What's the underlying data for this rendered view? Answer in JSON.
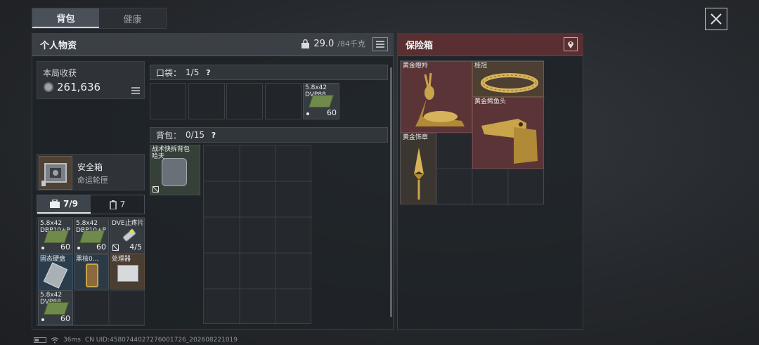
{
  "tabs": [
    {
      "label": "背包",
      "active": true
    },
    {
      "label": "健康",
      "active": false
    }
  ],
  "personal": {
    "title": "个人物资",
    "weight_current": "29.0",
    "weight_max": "/84千克",
    "earnings_label": "本局收获",
    "earnings_value": "261,636",
    "safe_box": {
      "name": "安全箱",
      "sub": "命运轮匣"
    },
    "subtabs": [
      {
        "label": "7/9",
        "icon": "toolbox-icon",
        "active": true
      },
      {
        "label": "7",
        "icon": "canister-icon",
        "active": false
      }
    ],
    "items": [
      {
        "name": "5.8x42\nDBP10+P",
        "count": "60"
      },
      {
        "name": "5.8x42\nDBP10+P",
        "count": "60"
      },
      {
        "name": "DVE止疼片",
        "count": "4/5"
      },
      {
        "name": "固态硬盘",
        "count": ""
      },
      {
        "name": "黑核0...",
        "count": ""
      },
      {
        "name": "处理器",
        "count": ""
      },
      {
        "name": "5.8x42\nDVP88",
        "count": "60"
      }
    ]
  },
  "pockets": {
    "label": "口袋：",
    "capacity": "1/5",
    "help": "?",
    "item": {
      "name": "5.8x42\nDVP88",
      "count": "60"
    }
  },
  "backpack": {
    "label": "背包：",
    "capacity": "0/15",
    "help": "?",
    "item": {
      "name": "战术快拆背包\n哈夫"
    }
  },
  "safe": {
    "title": "保险箱",
    "items": [
      {
        "name": "黄金瞪羚"
      },
      {
        "name": "桂冠"
      },
      {
        "name": "黄金鳄鱼头"
      },
      {
        "name": "黄金饰章"
      }
    ]
  },
  "status_bar": {
    "ping": "36ms",
    "uid": "CN UID:4580744027276001726_202608221019"
  },
  "colors": {
    "safe_header": "#5a2f31",
    "gold": "#c9a44a"
  }
}
